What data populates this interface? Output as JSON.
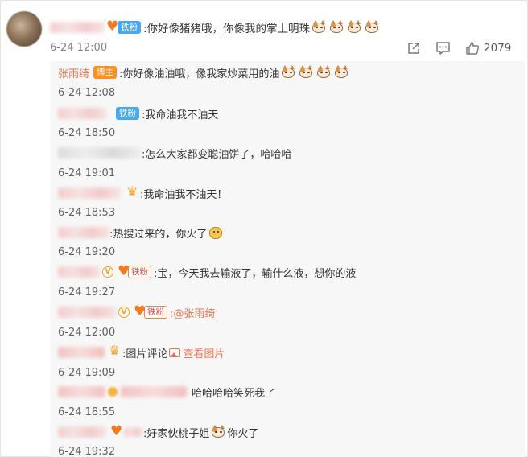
{
  "main_comment": {
    "badge": "铁粉",
    "text": ":你好像猪猪哦，你像我的掌上明珠",
    "emoji_count": 4,
    "date": "6-24 12:00",
    "like_count": "2079"
  },
  "replies": [
    {
      "author": "张雨绮",
      "badge": "博主",
      "text": ":你好像油油哦，像我家炒菜用的油",
      "date": "6-24 12:08"
    },
    {
      "badge": "铁粉",
      "text": ":我命油我不油天",
      "date": "6-24 18:50"
    },
    {
      "text": ":怎么大家都变聪油饼了，哈哈哈",
      "date": "6-24 19:01"
    },
    {
      "text": ":我命油我不油天！",
      "date": "6-24 18:53"
    },
    {
      "text": ":热搜过来的，你火了",
      "date": "6-24 19:20"
    },
    {
      "badge": "铁粉",
      "text": ":宝，今天我去输液了，输什么液，想你的液",
      "date": "6-24 19:27"
    },
    {
      "badge": "铁粉",
      "mention": ":@张雨绮",
      "date": "6-24 12:00"
    },
    {
      "text": ":图片评论",
      "link": "查看图片",
      "date": "6-24 19:09"
    },
    {
      "text": "哈哈哈哈笑死我了",
      "date": "6-24 18:55"
    },
    {
      "text": ":好家伙桃子姐",
      "text2": "你火了",
      "date": "6-24 19:32"
    }
  ],
  "colors": {
    "accent": "#eb7350",
    "fan_badge": "#4aa8ee",
    "owner_badge": "#ff8f1f",
    "reply_bg": "#f7f7f7"
  },
  "icons": [
    "share-icon",
    "comment-icon",
    "like-icon",
    "cat-emoji",
    "doge-emoji",
    "image-icon",
    "heart-fan-icon",
    "verified-icon"
  ]
}
